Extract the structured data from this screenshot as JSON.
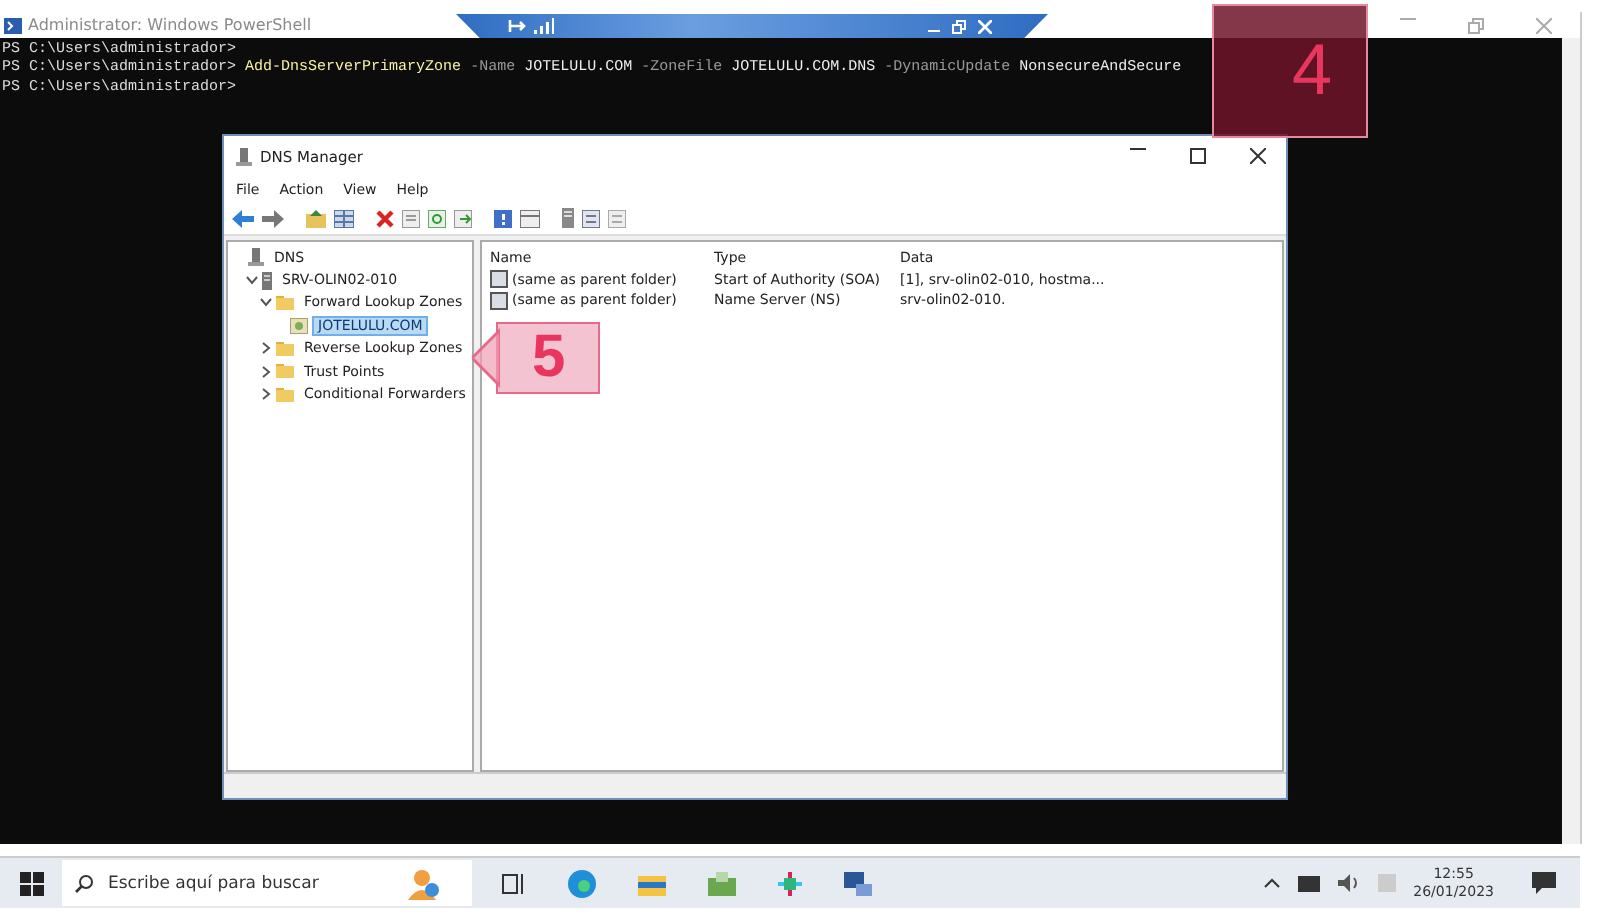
{
  "powershell": {
    "title": "Administrator: Windows PowerShell",
    "lines": [
      {
        "prompt": "PS C:\\Users\\administrador>"
      },
      {
        "prompt": "PS C:\\Users\\administrador>",
        "tokens": [
          {
            "kind": "command",
            "text": "Add-DnsServerPrimaryZone"
          },
          {
            "kind": "param",
            "text": "-Name"
          },
          {
            "kind": "value",
            "text": "JOTELULU.COM"
          },
          {
            "kind": "param",
            "text": "-ZoneFile"
          },
          {
            "kind": "value",
            "text": "JOTELULU.COM.DNS"
          },
          {
            "kind": "param",
            "text": "-DynamicUpdate"
          },
          {
            "kind": "value",
            "text": "NonsecureAndSecure"
          }
        ]
      },
      {
        "prompt": "PS C:\\Users\\administrador>"
      }
    ]
  },
  "dns_manager": {
    "title": "DNS Manager",
    "menu": [
      "File",
      "Action",
      "View",
      "Help"
    ],
    "tree": [
      {
        "label": "DNS",
        "kind": "root",
        "selected": false,
        "children": [
          {
            "label": "SRV-OLIN02-010",
            "kind": "server",
            "selected": false,
            "expanded": true,
            "children": [
              {
                "label": "Forward Lookup Zones",
                "kind": "folder",
                "selected": false,
                "expanded": true,
                "children": [
                  {
                    "label": "JOTELULU.COM",
                    "kind": "zone",
                    "selected": true
                  }
                ]
              },
              {
                "label": "Reverse Lookup Zones",
                "kind": "folder",
                "selected": false,
                "expanded": false
              },
              {
                "label": "Trust Points",
                "kind": "folder",
                "selected": false,
                "expanded": false
              },
              {
                "label": "Conditional Forwarders",
                "kind": "folder",
                "selected": false,
                "expanded": false
              }
            ]
          }
        ]
      }
    ],
    "columns": [
      "Name",
      "Type",
      "Data"
    ],
    "rows": [
      [
        "(same as parent folder)",
        "Start of Authority (SOA)",
        "[1], srv-olin02-010, hostma..."
      ],
      [
        "(same as parent folder)",
        "Name Server (NS)",
        "srv-olin02-010."
      ]
    ]
  },
  "callouts": [
    {
      "number": "4"
    },
    {
      "number": "5"
    }
  ],
  "taskbar": {
    "search": {
      "placeholder": "Escribe aquí para buscar"
    },
    "time": "12:55",
    "date": "26/01/2023"
  }
}
